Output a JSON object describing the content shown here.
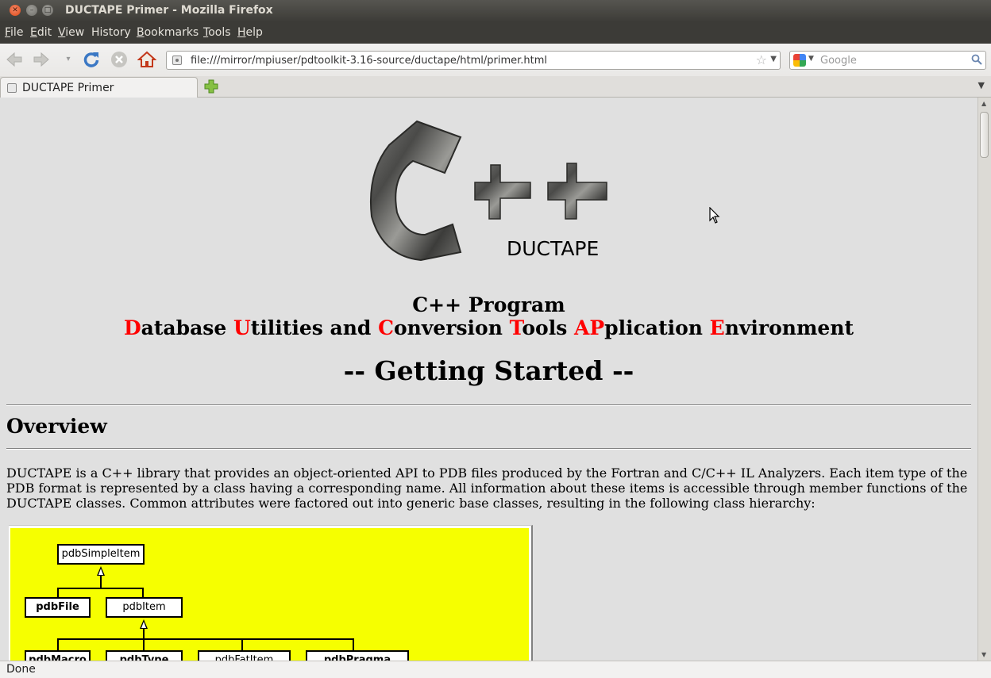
{
  "window": {
    "title": "DUCTAPE Primer - Mozilla Firefox",
    "close_glyph": "✕",
    "min_glyph": "–",
    "max_glyph": "□"
  },
  "menu": [
    {
      "label": "File",
      "key": "F",
      "rest": "ile"
    },
    {
      "label": "Edit",
      "key": "E",
      "rest": "dit"
    },
    {
      "label": "View",
      "key": "V",
      "rest": "iew"
    },
    {
      "label": "History",
      "key": "",
      "rest": "History"
    },
    {
      "label": "Bookmarks",
      "key": "B",
      "rest": "ookmarks"
    },
    {
      "label": "Tools",
      "key": "T",
      "rest": "ools"
    },
    {
      "label": "Help",
      "key": "H",
      "rest": "elp"
    }
  ],
  "toolbar": {
    "back_icon": "back-arrow-icon",
    "forward_icon": "forward-arrow-icon",
    "reload_icon": "reload-icon",
    "stop_icon": "stop-icon",
    "home_icon": "home-icon",
    "url": "file:///mirror/mpiuser/pdtoolkit-3.16-source/ductape/html/primer.html",
    "search_placeholder": "Google"
  },
  "tabs": [
    {
      "label": "DUCTAPE Primer",
      "active": true
    }
  ],
  "page": {
    "logo_caption": "DUCTAPE",
    "subtitle_line1": "C++ Program",
    "subtitle_line2": [
      {
        "text": "D",
        "red": true
      },
      {
        "text": "atabase ",
        "red": false
      },
      {
        "text": "U",
        "red": true
      },
      {
        "text": "tilities and ",
        "red": false
      },
      {
        "text": "C",
        "red": true
      },
      {
        "text": "onversion ",
        "red": false
      },
      {
        "text": "T",
        "red": true
      },
      {
        "text": "ools ",
        "red": false
      },
      {
        "text": "AP",
        "red": true
      },
      {
        "text": "plication ",
        "red": false
      },
      {
        "text": "E",
        "red": true
      },
      {
        "text": "nvironment",
        "red": false
      }
    ],
    "heading": "-- Getting Started --",
    "overview_heading": "Overview",
    "overview_paragraph": "DUCTAPE is a C++ library that provides an object-oriented API to PDB files produced by the Fortran and C/C++ IL Analyzers. Each item type of the PDB format is represented by a class having a corresponding name. All information about these items is accessible through member functions of the DUCTAPE classes. Common attributes were factored out into generic base classes, resulting in the following class hierarchy:",
    "diagram": {
      "classes": [
        "pdbSimpleItem",
        "pdbFile",
        "pdbItem",
        "pdbMacro",
        "pdbType",
        "pdbFatItem",
        "pdbPragma"
      ],
      "background": "#f6ff00"
    }
  },
  "status": "Done",
  "colors": {
    "accent_red": "#ff0000",
    "content_bg": "#e0e0e0",
    "titlebar_bg": "#3c3b37"
  }
}
